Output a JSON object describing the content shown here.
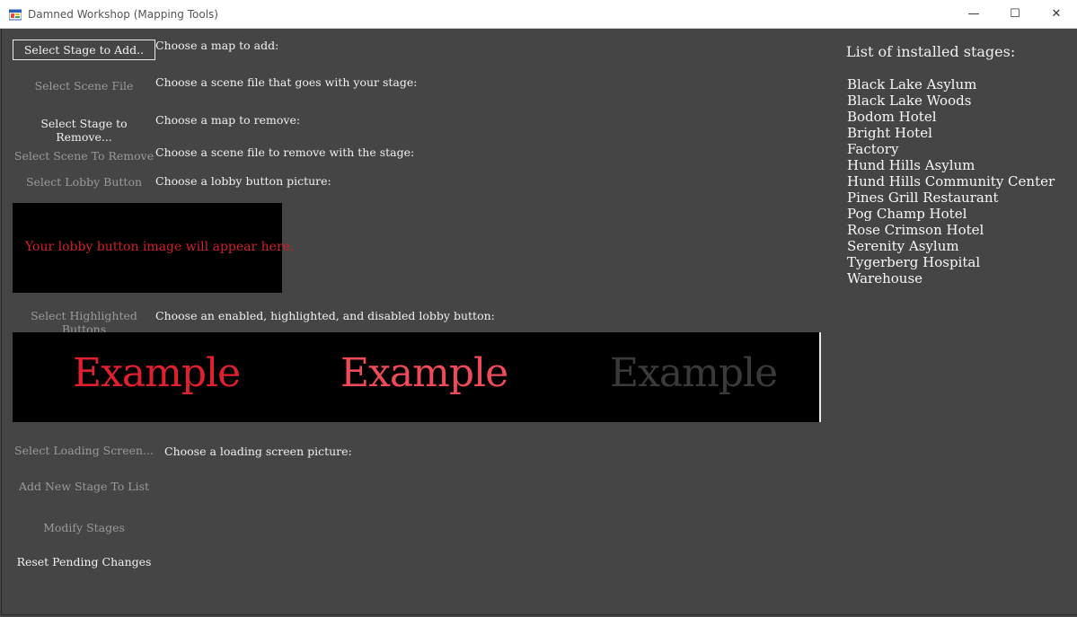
{
  "window": {
    "title": "Damned Workshop (Mapping Tools)",
    "minimize": "—",
    "maximize": "☐",
    "close": "✕"
  },
  "buttons": {
    "select_stage_add": "Select Stage to Add..",
    "select_scene_file": "Select Scene File",
    "select_stage_remove": "Select Stage to Remove...",
    "select_scene_remove": "Select Scene To Remove",
    "select_lobby_button": "Select Lobby Button",
    "select_highlighted": "Select Highlighted Buttons",
    "select_loading_screen": "Select Loading Screen...",
    "add_new_stage": "Add New Stage To List",
    "modify_stages": "Modify Stages",
    "reset_pending": "Reset Pending Changes"
  },
  "labels": {
    "choose_map_add": "Choose a map to add:",
    "choose_scene_file": "Choose a scene file that goes with your stage:",
    "choose_map_remove": "Choose a map to remove:",
    "choose_scene_remove": "Choose a scene file to remove with the stage:",
    "choose_lobby_picture": "Choose a lobby button picture:",
    "choose_highlighted": "Choose an enabled, highlighted, and disabled lobby button:",
    "choose_loading": "Choose a loading screen picture:"
  },
  "lobby_preview": {
    "placeholder": "Your lobby button image will appear here."
  },
  "highlight_preview": {
    "enabled": "Example",
    "highlighted": "Example",
    "disabled": "Example",
    "colors": {
      "enabled": "#e0202f",
      "highlighted": "#ee4a58",
      "disabled": "#3a3a3a"
    }
  },
  "stages": {
    "title": "List of installed stages:",
    "items": [
      "Black Lake Asylum",
      "Black Lake Woods",
      "Bodom Hotel",
      "Bright Hotel",
      "Factory",
      "Hund Hills Asylum",
      "Hund Hills Community Center",
      "Pines Grill Restaurant",
      "Pog Champ Hotel",
      "Rose Crimson Hotel",
      "Serenity Asylum",
      "Tygerberg Hospital",
      "Warehouse"
    ]
  }
}
